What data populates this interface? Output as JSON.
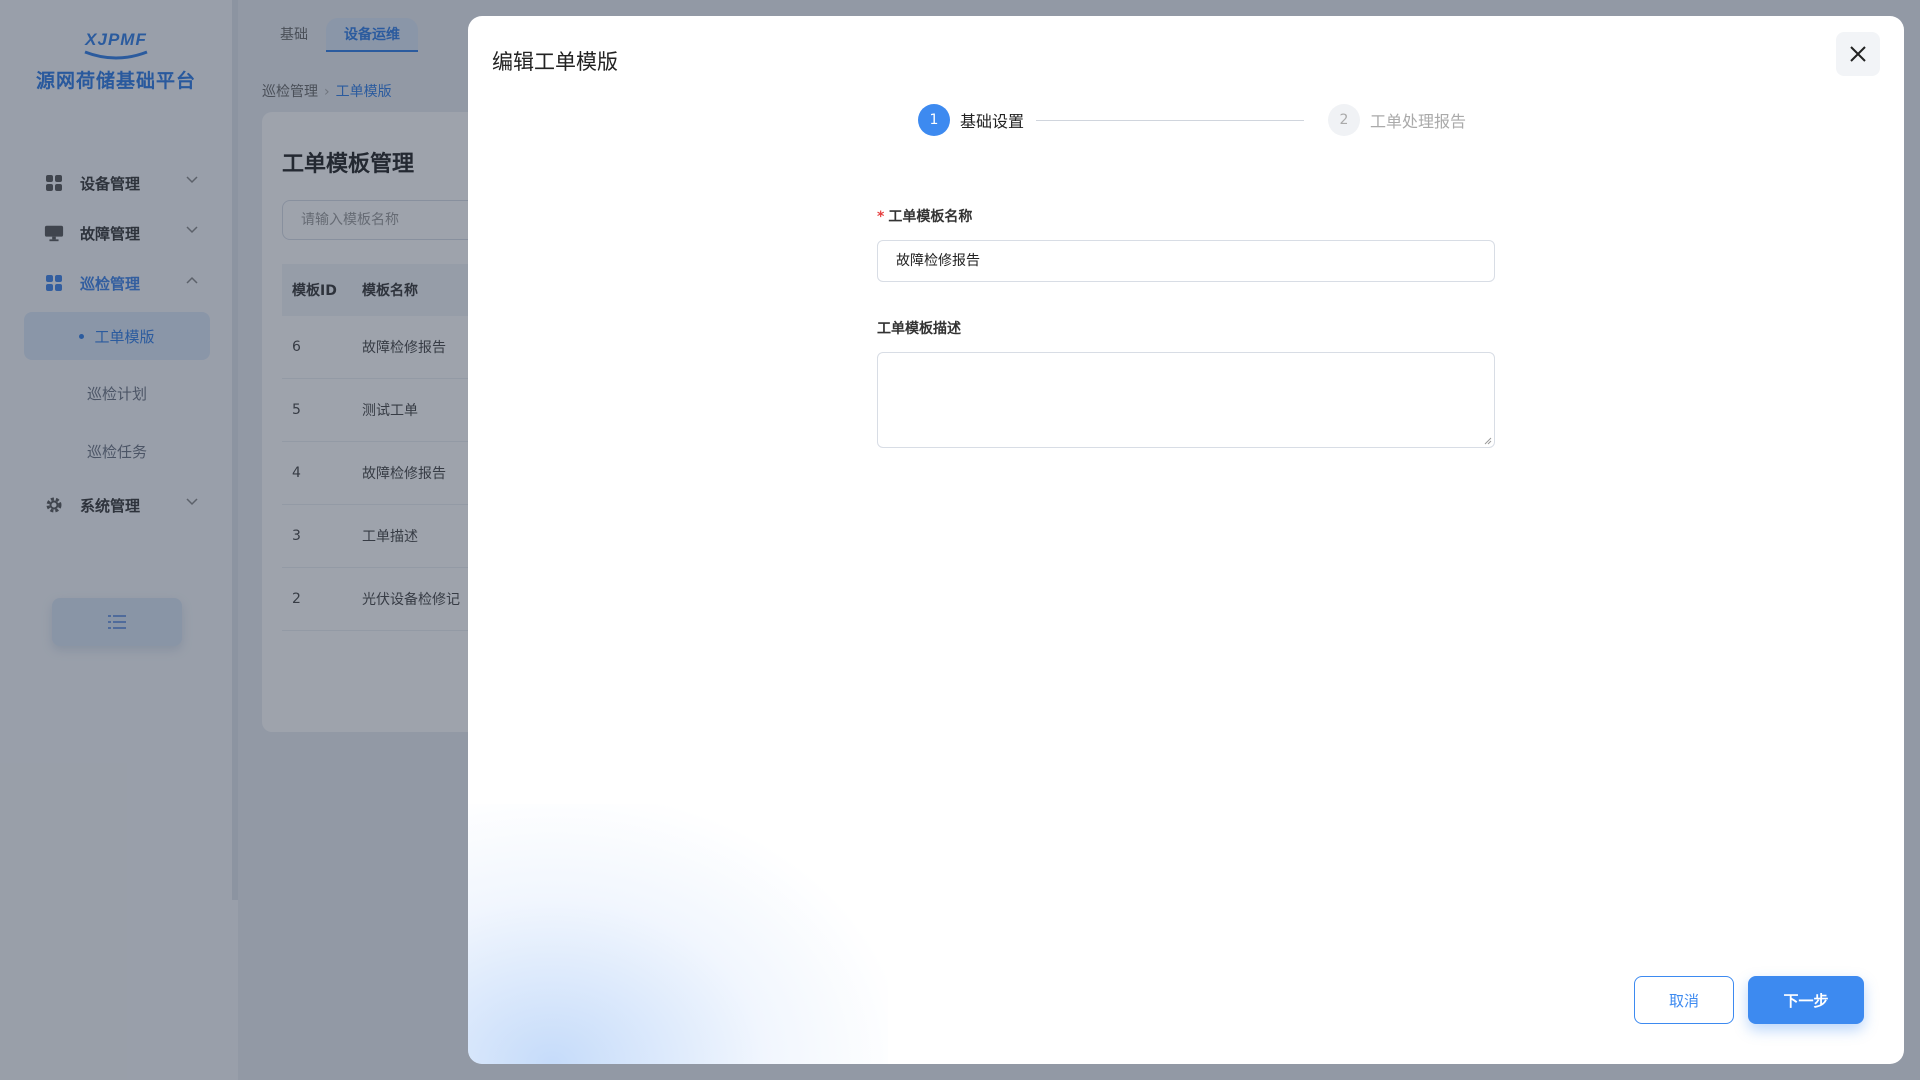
{
  "sidebar": {
    "logo_mark": "XJPMF",
    "logo_title": "源网荷储基础平台",
    "items": [
      {
        "label": "设备管理",
        "icon": "grid-icon"
      },
      {
        "label": "故障管理",
        "icon": "monitor-icon"
      },
      {
        "label": "巡检管理",
        "icon": "grid-icon"
      },
      {
        "label": "系统管理",
        "icon": "gear-icon"
      }
    ],
    "sub_items": [
      {
        "label": "工单模版"
      },
      {
        "label": "巡检计划"
      },
      {
        "label": "巡检任务"
      }
    ]
  },
  "tabs": [
    {
      "label": "基础"
    },
    {
      "label": "设备运维"
    }
  ],
  "breadcrumb": {
    "parent": "巡检管理",
    "current": "工单模版"
  },
  "panel": {
    "title": "工单模板管理",
    "search_placeholder": "请输入模板名称",
    "columns": [
      "模板ID",
      "模板名称"
    ],
    "rows": [
      {
        "id": "6",
        "name": "故障检修报告"
      },
      {
        "id": "5",
        "name": "测试工单"
      },
      {
        "id": "4",
        "name": "故障检修报告"
      },
      {
        "id": "3",
        "name": "工单描述"
      },
      {
        "id": "2",
        "name": "光伏设备检修记"
      }
    ]
  },
  "dialog": {
    "title": "编辑工单模版",
    "steps": [
      {
        "num": "1",
        "label": "基础设置"
      },
      {
        "num": "2",
        "label": "工单处理报告"
      }
    ],
    "name_label": "工单模板名称",
    "name_required_mark": "*",
    "name_value": "故障检修报告",
    "desc_label": "工单模板描述",
    "desc_value": "",
    "cancel_label": "取消",
    "next_label": "下一步"
  },
  "colors": {
    "primary": "#3d8af0",
    "required": "#e53e3e"
  }
}
